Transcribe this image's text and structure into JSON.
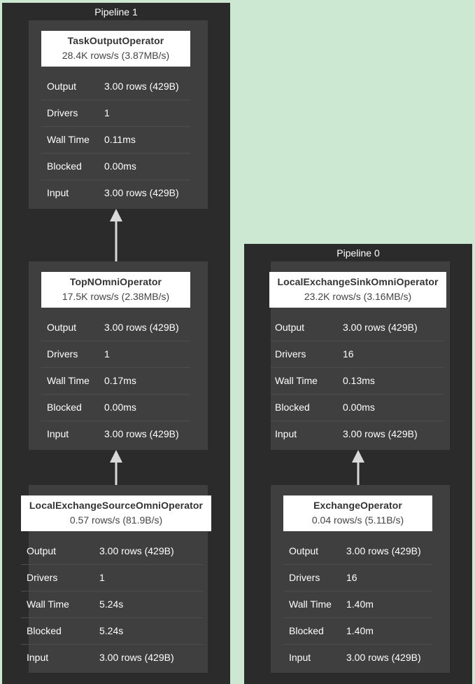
{
  "pipelines": [
    {
      "title": "Pipeline 1",
      "operators": [
        {
          "name": "TaskOutputOperator",
          "rate": "28.4K rows/s (3.87MB/s)",
          "stats": [
            {
              "label": "Output",
              "value": "3.00 rows (429B)"
            },
            {
              "label": "Drivers",
              "value": "1"
            },
            {
              "label": "Wall Time",
              "value": "0.11ms"
            },
            {
              "label": "Blocked",
              "value": "0.00ms"
            },
            {
              "label": "Input",
              "value": "3.00 rows (429B)"
            }
          ]
        },
        {
          "name": "TopNOmniOperator",
          "rate": "17.5K rows/s (2.38MB/s)",
          "stats": [
            {
              "label": "Output",
              "value": "3.00 rows (429B)"
            },
            {
              "label": "Drivers",
              "value": "1"
            },
            {
              "label": "Wall Time",
              "value": "0.17ms"
            },
            {
              "label": "Blocked",
              "value": "0.00ms"
            },
            {
              "label": "Input",
              "value": "3.00 rows (429B)"
            }
          ]
        },
        {
          "name": "LocalExchangeSourceOmniOperator",
          "rate": "0.57 rows/s (81.9B/s)",
          "stats": [
            {
              "label": "Output",
              "value": "3.00 rows (429B)"
            },
            {
              "label": "Drivers",
              "value": "1"
            },
            {
              "label": "Wall Time",
              "value": "5.24s"
            },
            {
              "label": "Blocked",
              "value": "5.24s"
            },
            {
              "label": "Input",
              "value": "3.00 rows (429B)"
            }
          ]
        }
      ]
    },
    {
      "title": "Pipeline 0",
      "operators": [
        {
          "name": "LocalExchangeSinkOmniOperator",
          "rate": "23.2K rows/s (3.16MB/s)",
          "stats": [
            {
              "label": "Output",
              "value": "3.00 rows (429B)"
            },
            {
              "label": "Drivers",
              "value": "16"
            },
            {
              "label": "Wall Time",
              "value": "0.13ms"
            },
            {
              "label": "Blocked",
              "value": "0.00ms"
            },
            {
              "label": "Input",
              "value": "3.00 rows (429B)"
            }
          ]
        },
        {
          "name": "ExchangeOperator",
          "rate": "0.04 rows/s (5.11B/s)",
          "stats": [
            {
              "label": "Output",
              "value": "3.00 rows (429B)"
            },
            {
              "label": "Drivers",
              "value": "16"
            },
            {
              "label": "Wall Time",
              "value": "1.40m"
            },
            {
              "label": "Blocked",
              "value": "1.40m"
            },
            {
              "label": "Input",
              "value": "3.00 rows (429B)"
            }
          ]
        }
      ]
    }
  ],
  "colors": {
    "background": "#cde8d2",
    "pipeline": "#2b2b2b",
    "operator": "#3f3f3f",
    "header": "#ffffff",
    "arrow": "#d9d9d9"
  }
}
